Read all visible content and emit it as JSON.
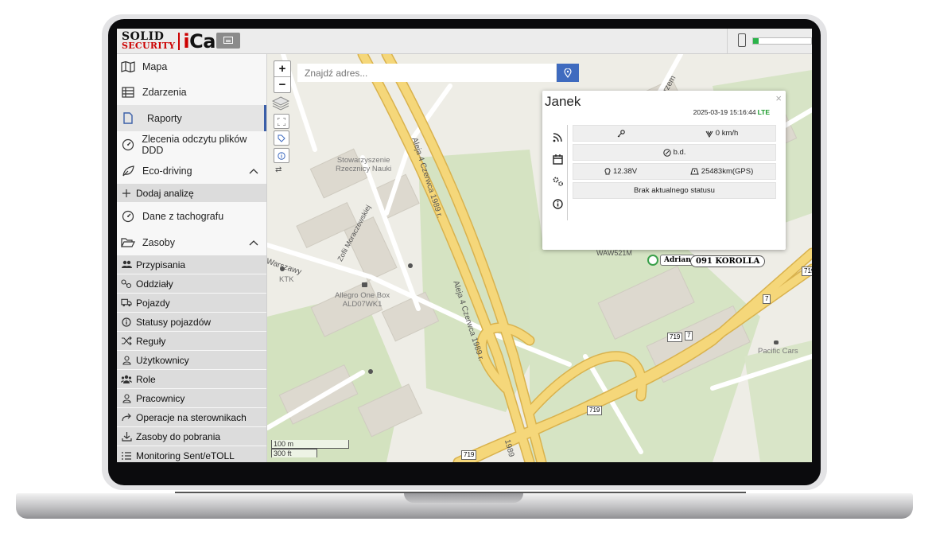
{
  "logo": {
    "line1": "SOLID",
    "line2": "SECURITY",
    "i": "i",
    "car": "Car"
  },
  "sidebar": {
    "items": [
      {
        "label": "Mapa",
        "icon": "map-icon"
      },
      {
        "label": "Zdarzenia",
        "icon": "table-icon"
      },
      {
        "label": "Raporty",
        "icon": "file-icon"
      },
      {
        "label": "Zlecenia odczytu plików DDD",
        "icon": "gauge-icon"
      },
      {
        "label": "Eco-driving",
        "icon": "leaf-icon"
      },
      {
        "label": "Dane z tachografu",
        "icon": "gauge-icon"
      },
      {
        "label": "Zasoby",
        "icon": "folder-open-icon"
      }
    ],
    "eco_sub": [
      {
        "label": "Dodaj analizę",
        "icon": "plus-icon"
      }
    ],
    "zasoby_sub": [
      {
        "label": "Przypisania",
        "icon": "users-icon"
      },
      {
        "label": "Oddziały",
        "icon": "nodes-icon"
      },
      {
        "label": "Pojazdy",
        "icon": "truck-icon"
      },
      {
        "label": "Statusy pojazdów",
        "icon": "info-icon"
      },
      {
        "label": "Reguły",
        "icon": "shuffle-icon"
      },
      {
        "label": "Użytkownicy",
        "icon": "user-icon"
      },
      {
        "label": "Role",
        "icon": "user-group-icon"
      },
      {
        "label": "Pracownicy",
        "icon": "user-icon"
      },
      {
        "label": "Operacje na sterownikach",
        "icon": "share-arrow-icon"
      },
      {
        "label": "Zasoby do pobrania",
        "icon": "download-icon"
      },
      {
        "label": "Monitoring Sent/eTOLL",
        "icon": "list-icon"
      }
    ]
  },
  "map": {
    "search": {
      "placeholder": "Znajdź adres..."
    },
    "zoom_in": "+",
    "zoom_out": "−",
    "scale": {
      "metric": "100 m",
      "imperial": "300 ft"
    },
    "labels": {
      "alley1": "Aleja 4 Czerwca 1989 r.",
      "alley2": "Aleja 4 Czerwca 1989 r.",
      "alley3": "1989",
      "stow1": "Stowarzyszenie",
      "stow2": "Rzecznicy Nauki",
      "zofii": "Zofii Moraczewskiej",
      "warszawy": "Warszawy",
      "ktk": "KTK",
      "allegro1": "Allegro One Box",
      "allegro2": "ALD07WK1",
      "pacific": "Pacific Cars",
      "waw": "WAW521M",
      "adrian": "Adrian",
      "korolla": "091 KOROLLA",
      "r719a": "719",
      "r7a": "7",
      "r719b": "719",
      "r7b": "7",
      "r719c": "719",
      "r719d": "719",
      "przem": "Przem"
    }
  },
  "popup": {
    "title": "Janek",
    "close": "×",
    "timestamp": "2025-03-19 15:16:44",
    "network": "LTE",
    "speed": "0 km/h",
    "driver": "b.d.",
    "voltage": "12.38V",
    "odometer": "25483km(GPS)",
    "status": "Brak aktualnego statusu"
  },
  "colors": {
    "accent": "#3f6bbf",
    "road_major": "#f5d77a",
    "road_edge": "#d9b24d",
    "green": "#cfe0b8",
    "status_green": "#2bb34a"
  }
}
